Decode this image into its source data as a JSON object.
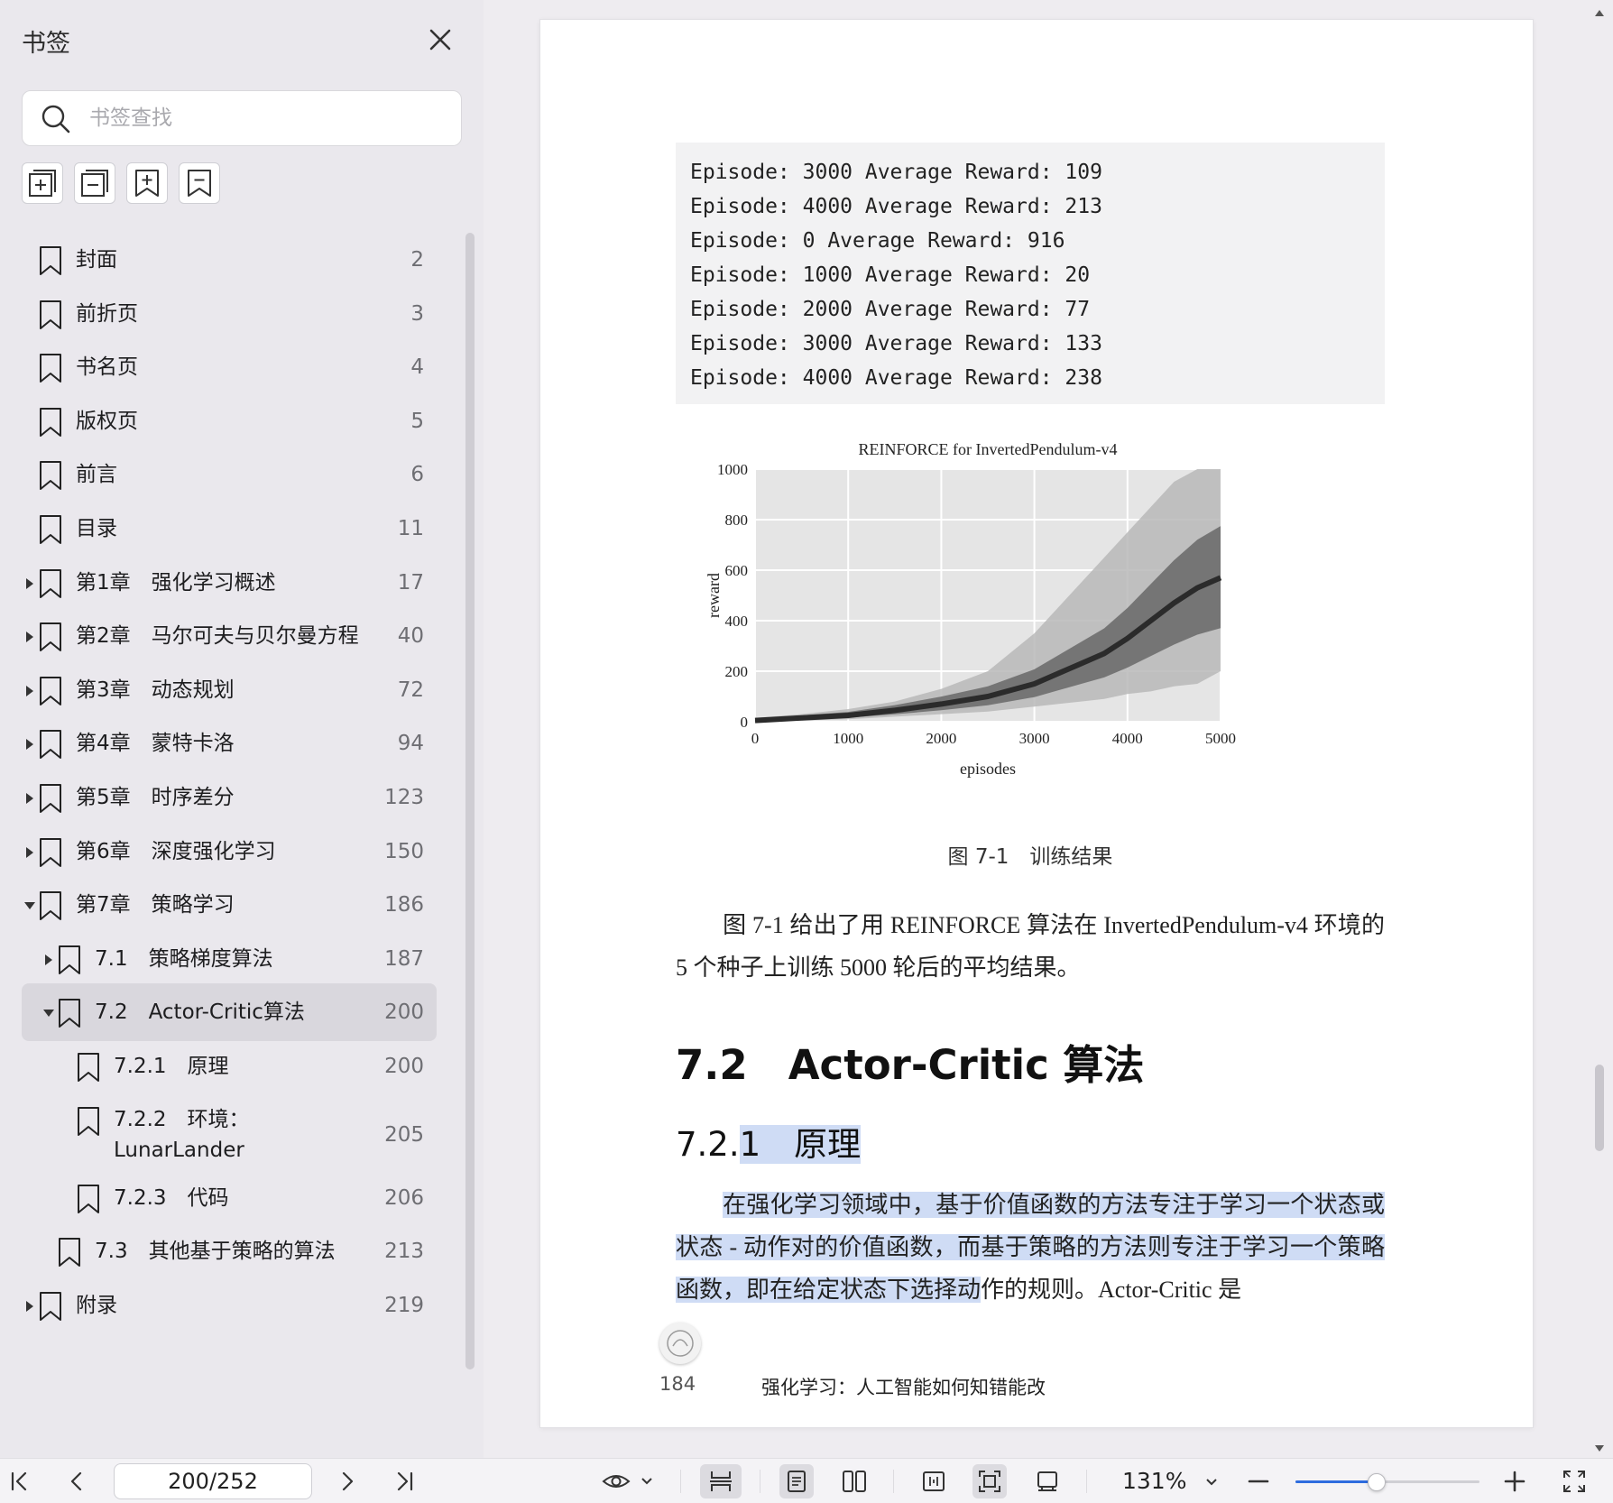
{
  "sidebar": {
    "title": "书签",
    "search_placeholder": "书签查找",
    "tools": [
      "expand-all-icon",
      "collapse-all-icon",
      "add-bookmark-icon",
      "remove-bookmark-icon"
    ],
    "items": [
      {
        "label": "封面",
        "page": "2",
        "level": 0,
        "arrow": "none"
      },
      {
        "label": "前折页",
        "page": "3",
        "level": 0,
        "arrow": "none"
      },
      {
        "label": "书名页",
        "page": "4",
        "level": 0,
        "arrow": "none"
      },
      {
        "label": "版权页",
        "page": "5",
        "level": 0,
        "arrow": "none"
      },
      {
        "label": "前言",
        "page": "6",
        "level": 0,
        "arrow": "none"
      },
      {
        "label": "目录",
        "page": "11",
        "level": 0,
        "arrow": "none"
      },
      {
        "label": "第1章　强化学习概述",
        "page": "17",
        "level": 0,
        "arrow": "right"
      },
      {
        "label": "第2章　马尔可夫与贝尔曼方程",
        "page": "40",
        "level": 0,
        "arrow": "right"
      },
      {
        "label": "第3章　动态规划",
        "page": "72",
        "level": 0,
        "arrow": "right"
      },
      {
        "label": "第4章　蒙特卡洛",
        "page": "94",
        "level": 0,
        "arrow": "right"
      },
      {
        "label": "第5章　时序差分",
        "page": "123",
        "level": 0,
        "arrow": "right"
      },
      {
        "label": "第6章　深度强化学习",
        "page": "150",
        "level": 0,
        "arrow": "right"
      },
      {
        "label": "第7章　策略学习",
        "page": "186",
        "level": 0,
        "arrow": "down"
      },
      {
        "label": "7.1　策略梯度算法",
        "page": "187",
        "level": 1,
        "arrow": "right"
      },
      {
        "label": "7.2　Actor-Critic算法",
        "page": "200",
        "level": 1,
        "arrow": "down",
        "selected": true
      },
      {
        "label": "7.2.1　原理",
        "page": "200",
        "level": 2,
        "arrow": "none"
      },
      {
        "label": "7.2.2　环境：LunarLander",
        "page": "205",
        "level": 2,
        "arrow": "none",
        "wrap": true
      },
      {
        "label": "7.2.3　代码",
        "page": "206",
        "level": 2,
        "arrow": "none"
      },
      {
        "label": "7.3　其他基于策略的算法",
        "page": "213",
        "level": 1,
        "arrow": "none"
      },
      {
        "label": "附录",
        "page": "219",
        "level": 0,
        "arrow": "right"
      }
    ]
  },
  "document": {
    "code_lines": [
      "Episode: 3000 Average Reward: 109",
      "Episode: 4000 Average Reward: 213",
      "Episode: 0 Average Reward: 916",
      "Episode: 1000 Average Reward: 20",
      "Episode: 2000 Average Reward: 77",
      "Episode: 3000 Average Reward: 133",
      "Episode: 4000 Average Reward: 238"
    ],
    "figure_caption": "图 7-1　训练结果",
    "para1": "图 7-1 给出了用 REINFORCE 算法在 InvertedPendulum-v4 环境的 5 个种子上训练 5000 轮后的平均结果。",
    "heading_section": "7.2　Actor-Critic 算法",
    "heading_sub_a": "7.2.",
    "heading_sub_b": "1　原理",
    "para2_highlighted": "在强化学习领域中，基于价值函数的方法专注于学习一个状态或状态 - 动作对的价值函数，而基于策略的方法则专注于学习一个策略函数，即在给定状态下选择动",
    "para2_rest": "作的规则。Actor-Critic 是",
    "footer_page": "184",
    "footer_book": "强化学习：人工智能如何知错能改"
  },
  "chart_data": {
    "type": "line",
    "title": "REINFORCE for InvertedPendulum-v4",
    "xlabel": "episodes",
    "ylabel": "reward",
    "xlim": [
      0,
      5000
    ],
    "ylim": [
      0,
      1000
    ],
    "xticks": [
      "0",
      "1000",
      "2000",
      "3000",
      "4000",
      "5000"
    ],
    "yticks": [
      "0",
      "200",
      "400",
      "600",
      "800",
      "1000"
    ],
    "grid": true,
    "x": [
      0,
      500,
      1000,
      1500,
      2000,
      2500,
      3000,
      3250,
      3500,
      3750,
      4000,
      4250,
      4500,
      4750,
      5000
    ],
    "series": [
      {
        "values": [
          5,
          15,
          25,
          45,
          70,
          100,
          150,
          190,
          230,
          270,
          330,
          400,
          470,
          530,
          570
        ]
      }
    ],
    "band_lower": [
      0,
      5,
      10,
      20,
      30,
      40,
      60,
      70,
      80,
      90,
      110,
      120,
      140,
      150,
      200
    ],
    "band_upper": [
      15,
      30,
      50,
      80,
      130,
      200,
      350,
      450,
      550,
      650,
      750,
      850,
      950,
      1000,
      1000
    ],
    "colors": {
      "mean": "#2b2b2b",
      "band_dark": "#6d6d6d",
      "band_light": "#b9b9b9",
      "plot_bg": "#e5e5e5"
    }
  },
  "toolbar": {
    "page_indicator": "200/252",
    "zoom": "131%",
    "zoom_fraction": 0.44,
    "accent": "#2d6cdf"
  }
}
